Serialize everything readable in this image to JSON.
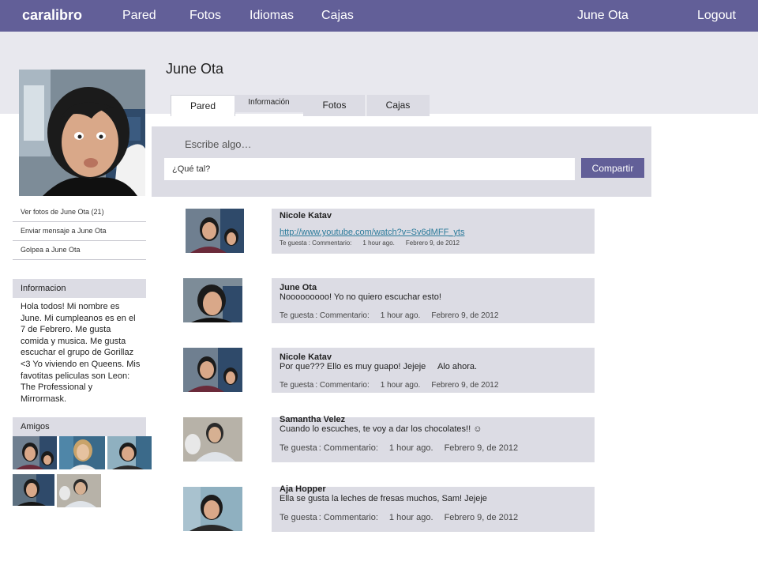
{
  "topbar": {
    "brand": "caralibro",
    "nav": [
      "Pared",
      "Fotos",
      "Idiomas",
      "Cajas"
    ],
    "user_name": "June Ota",
    "logout": "Logout"
  },
  "profile": {
    "name": "June Ota"
  },
  "sidebar": {
    "links": [
      "Ver fotos de June Ota (21)",
      "Enviar mensaje a June Ota",
      "Golpea a June Ota"
    ],
    "info_heading": "Informacion",
    "info_text": "Hola todos! Mi nombre es June. Mi cumpleanos es en el 7 de Febrero. Me gusta comida y musica. Me gusta escuchar el grupo de Gorillaz <3 Yo viviendo en Queens. Mis favotitas peliculas son Leon: The Professional y Mirrormask.",
    "friends_heading": "Amigos"
  },
  "tabs": [
    "Pared",
    "Información",
    "Fotos",
    "Cajas"
  ],
  "composer": {
    "prompt": "Escribe algo…",
    "input_value": "¿Qué tal?",
    "share_label": "Compartir"
  },
  "posts": [
    {
      "author": "Nicole Katav",
      "text": "",
      "link": "http://www.youtube.com/watch?v=Sv6dMFF_yts",
      "like": "Te guesta",
      "comment": ": Commentario:",
      "time": "1 hour ago.",
      "date": "Febrero 9, de 2012"
    },
    {
      "author": "June Ota",
      "text": "Nooooooooo! Yo no quiero escuchar esto!",
      "like": "Te guesta",
      "comment": ": Commentario:",
      "time": "1 hour ago.",
      "date": "Febrero 9, de 2012"
    },
    {
      "author": "Nicole Katav",
      "text": "Por que??? Ello es muy guapo! Jejeje     Alo ahora.",
      "like": "Te guesta",
      "comment": ": Commentario:",
      "time": "1 hour ago.",
      "date": "Febrero 9, de 2012"
    },
    {
      "author": "Samantha Velez",
      "text": "Cuando lo escuches, te voy a dar los chocolates!! ☺",
      "like": "Te guesta",
      "comment": ": Commentario:",
      "time": "1 hour ago.",
      "date": "Febrero 9,  de 2012"
    },
    {
      "author": "Aja Hopper",
      "text": "Ella se gusta la leches de fresas muchos, Sam! Jejeje",
      "like": "Te guesta",
      "comment": ": Commentario:",
      "time": "1 hour ago.",
      "date": "Febrero 9,  de 2012"
    }
  ],
  "colors": {
    "brand": "#625f98",
    "panel": "#dcdce4",
    "band": "#e8e8ee",
    "link": "#2a7a9a"
  }
}
